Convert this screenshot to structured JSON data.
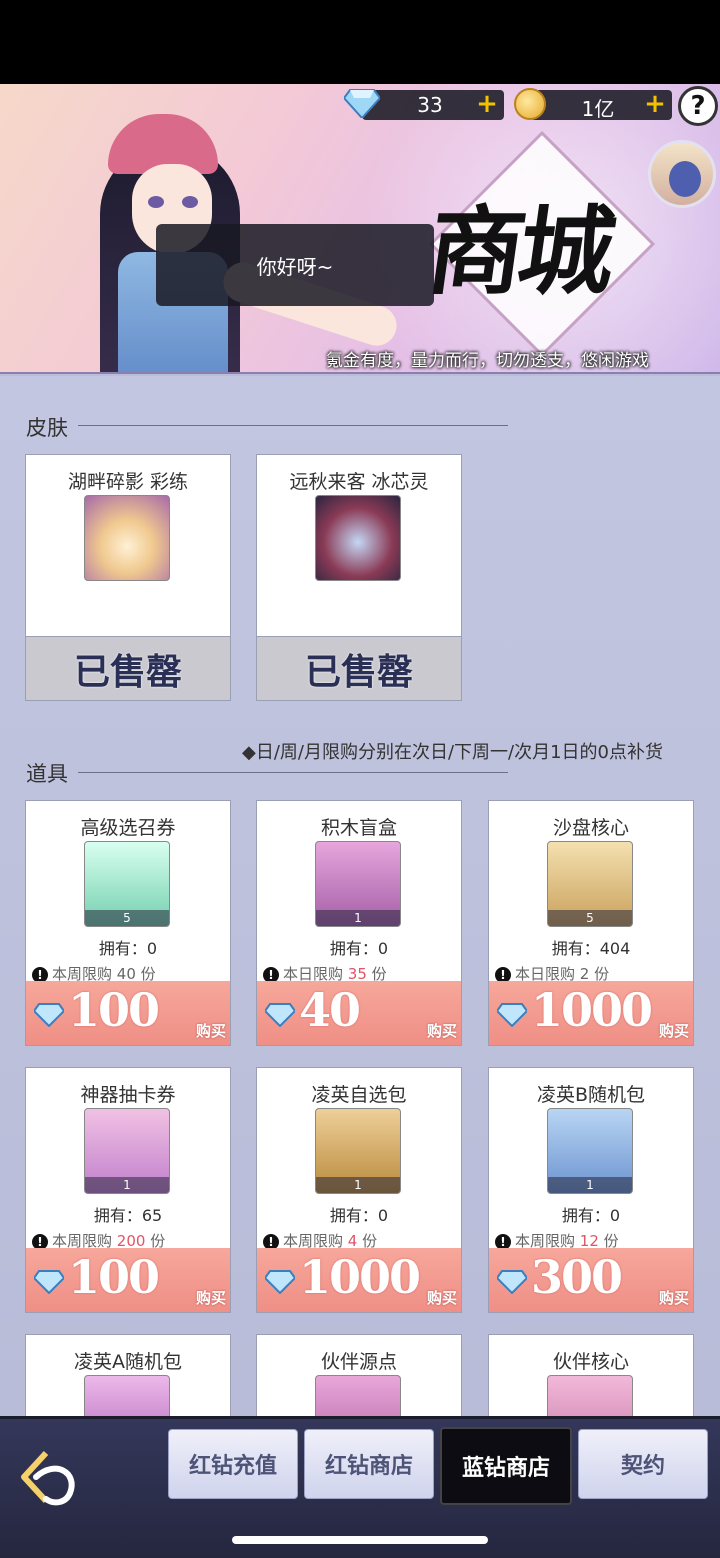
{
  "header": {
    "blue_diamonds": "33",
    "gold": "1亿",
    "help_label": "?",
    "speech": "你好呀~",
    "title": "商城",
    "slogan": "氪金有度，量力而行，切勿透支，悠闲游戏"
  },
  "skins": {
    "title": "皮肤",
    "items": [
      {
        "name": "湖畔碎影 彩练",
        "status": "已售罄"
      },
      {
        "name": "远秋来客 冰芯灵",
        "status": "已售罄"
      }
    ]
  },
  "items": {
    "title": "道具",
    "notice": "◆日/周/月限购分别在次日/下周一/次月1日的0点补货",
    "list": [
      {
        "name": "高级选召券",
        "qty": "5",
        "own": "拥有：0",
        "limit_prefix": "本周限购",
        "limit_num": "40",
        "limit_suffix": "份",
        "price": "100",
        "buy": "购买"
      },
      {
        "name": "积木盲盒",
        "qty": "1",
        "own": "拥有：0",
        "limit_prefix": "本日限购",
        "limit_num": "35",
        "limit_suffix": "份",
        "price": "40",
        "buy": "购买"
      },
      {
        "name": "沙盘核心",
        "qty": "5",
        "own": "拥有：404",
        "limit_prefix": "本日限购",
        "limit_num": "2",
        "limit_suffix": "份",
        "price": "1000",
        "buy": "购买"
      },
      {
        "name": "神器抽卡券",
        "qty": "1",
        "own": "拥有：65",
        "limit_prefix": "本周限购",
        "limit_num": "200",
        "limit_suffix": "份",
        "price": "100",
        "buy": "购买"
      },
      {
        "name": "凌英自选包",
        "qty": "1",
        "own": "拥有：0",
        "limit_prefix": "本周限购",
        "limit_num": "4",
        "limit_suffix": "份",
        "price": "1000",
        "buy": "购买"
      },
      {
        "name": "凌英B随机包",
        "qty": "1",
        "own": "拥有：0",
        "limit_prefix": "本周限购",
        "limit_num": "12",
        "limit_suffix": "份",
        "price": "300",
        "buy": "购买"
      },
      {
        "name": "凌英A随机包"
      },
      {
        "name": "伙伴源点"
      },
      {
        "name": "伙伴核心"
      }
    ]
  },
  "nav": {
    "tabs": [
      {
        "label": "红钻充值"
      },
      {
        "label": "红钻商店"
      },
      {
        "label": "蓝钻商店",
        "active": true
      },
      {
        "label": "契约"
      }
    ]
  },
  "colors": {
    "price_bg": "#ef8f86",
    "limit_highlight": "#e05566",
    "nav_bg": "#2c2e48"
  }
}
